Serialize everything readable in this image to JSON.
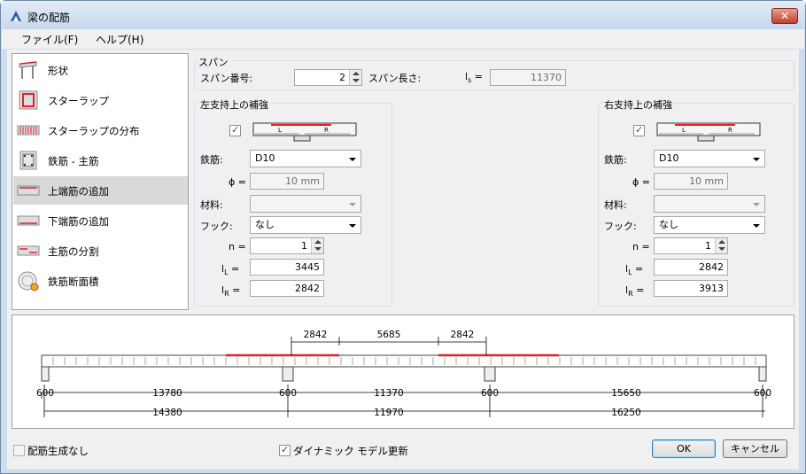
{
  "window": {
    "title": "梁の配筋"
  },
  "menu": {
    "file": "ファイル(F)",
    "help": "ヘルプ(H)"
  },
  "nav": {
    "items": [
      {
        "label": "形状",
        "icon": "shape-icon"
      },
      {
        "label": "スターラップ",
        "icon": "stirrup-icon"
      },
      {
        "label": "スターラップの分布",
        "icon": "stirrup-distribution-icon"
      },
      {
        "label": "鉄筋 - 主筋",
        "icon": "main-rebar-icon"
      },
      {
        "label": "上端筋の追加",
        "icon": "top-bars-icon"
      },
      {
        "label": "下端筋の追加",
        "icon": "bottom-bars-icon"
      },
      {
        "label": "主筋の分割",
        "icon": "bar-split-icon"
      },
      {
        "label": "鉄筋断面積",
        "icon": "rebar-area-icon"
      }
    ],
    "selected": "上端筋の追加"
  },
  "span": {
    "group_title": "スパン",
    "number_label": "スパン番号:",
    "number_value": "2",
    "length_label": "スパン長さ:",
    "ls_label": "l",
    "ls_sub": "s",
    "eq": "=",
    "length_value": "11370"
  },
  "left": {
    "group_title": "左支持上の補強",
    "rebar_label": "鉄筋:",
    "rebar_value": "D10",
    "phi_label": "ϕ =",
    "phi_value": "10 mm",
    "material_label": "材料:",
    "material_value": "",
    "hook_label": "フック:",
    "hook_value": "なし",
    "n_label": "n =",
    "n_value": "1",
    "l_label": "l",
    "L_sub": "L",
    "R_sub": "R",
    "lL_value": "3445",
    "lR_value": "2842",
    "enabled": true
  },
  "right": {
    "group_title": "右支持上の補強",
    "rebar_label": "鉄筋:",
    "rebar_value": "D10",
    "phi_label": "ϕ =",
    "phi_value": "10 mm",
    "material_label": "材料:",
    "material_value": "",
    "hook_label": "フック:",
    "hook_value": "なし",
    "n_label": "n =",
    "n_value": "1",
    "l_label": "l",
    "L_sub": "L",
    "R_sub": "R",
    "lL_value": "2842",
    "lR_value": "3913",
    "enabled": true
  },
  "section_icon": {
    "L": "L",
    "R": "R"
  },
  "beam": {
    "top_dims": [
      "2842",
      "5685",
      "2842"
    ],
    "support": "600",
    "clear_spans": [
      "13780",
      "11370",
      "15650"
    ],
    "axis_spans": [
      "14380",
      "11970",
      "16250"
    ]
  },
  "footer": {
    "no_rebar_label": "配筋生成なし",
    "no_rebar_checked": false,
    "dynamic_label": "ダイナミック モデル更新",
    "dynamic_checked": true,
    "ok": "OK",
    "cancel": "キャンセル"
  },
  "colors": {
    "rebar": "#e0202a",
    "title_bg": "#c8d8ec",
    "close": "#c2412c"
  }
}
